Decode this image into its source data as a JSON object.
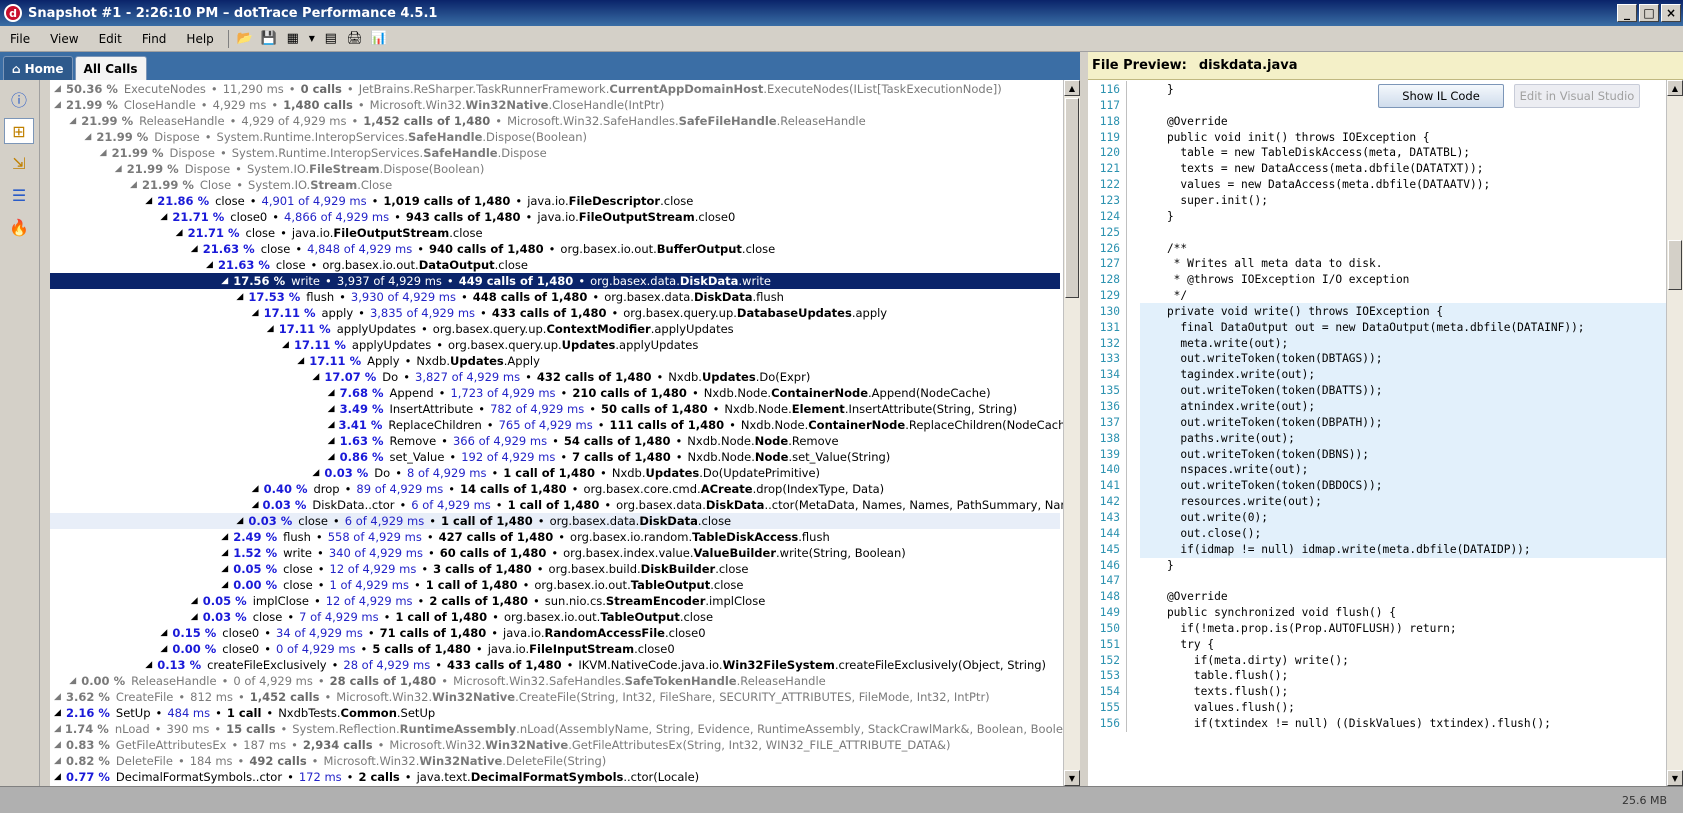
{
  "window": {
    "title": "Snapshot #1 - 2:26:10 PM – dotTrace Performance 4.5.1",
    "icon": "dottrace-logo-icon"
  },
  "menu": [
    "File",
    "View",
    "Edit",
    "Find",
    "Help"
  ],
  "tabs": [
    {
      "label": "Home",
      "icon": "home-icon"
    },
    {
      "label": "All Calls"
    }
  ],
  "sidebar": [
    "info-icon",
    "call-tree-icon",
    "back-traces-icon",
    "list-icon",
    "hotspots-icon"
  ],
  "preview": {
    "label": "File Preview:",
    "file": "diskdata.java",
    "show_il": "Show IL Code",
    "edit_vs": "Edit in Visual Studio"
  },
  "status": {
    "memory": "25.6 MB"
  },
  "tree": [
    {
      "d": 0,
      "g": 1,
      "pct": "50.36 %",
      "name": "ExecuteNodes",
      "ms": "11,290 ms",
      "calls": "0 calls",
      "pre": "JetBrains.ReSharper.TaskRunnerFramework.",
      "bold": "CurrentAppDomainHost",
      "post": ".ExecuteNodes(IList[TaskExecutionNode])"
    },
    {
      "d": 0,
      "g": 1,
      "pct": "21.99 %",
      "name": "CloseHandle",
      "ms": "4,929 ms",
      "calls": "1,480 calls",
      "pre": "Microsoft.Win32.",
      "bold": "Win32Native",
      "post": ".CloseHandle(IntPtr)"
    },
    {
      "d": 1,
      "g": 1,
      "pct": "21.99 %",
      "name": "ReleaseHandle",
      "ms": "4,929 of 4,929 ms",
      "calls": "1,452 calls of 1,480",
      "pre": "Microsoft.Win32.SafeHandles.",
      "bold": "SafeFileHandle",
      "post": ".ReleaseHandle"
    },
    {
      "d": 2,
      "g": 1,
      "pct": "21.99 %",
      "name": "Dispose",
      "ms": "",
      "calls": "",
      "pre": "System.Runtime.InteropServices.",
      "bold": "SafeHandle",
      "post": ".Dispose(Boolean)"
    },
    {
      "d": 3,
      "g": 1,
      "pct": "21.99 %",
      "name": "Dispose",
      "ms": "",
      "calls": "",
      "pre": "System.Runtime.InteropServices.",
      "bold": "SafeHandle",
      "post": ".Dispose"
    },
    {
      "d": 4,
      "g": 1,
      "pct": "21.99 %",
      "name": "Dispose",
      "ms": "",
      "calls": "",
      "pre": "System.IO.",
      "bold": "FileStream",
      "post": ".Dispose(Boolean)"
    },
    {
      "d": 5,
      "g": 1,
      "pct": "21.99 %",
      "name": "Close",
      "ms": "",
      "calls": "",
      "pre": "System.IO.",
      "bold": "Stream",
      "post": ".Close"
    },
    {
      "d": 6,
      "g": 0,
      "pct": "21.86 %",
      "name": "close",
      "ms": "4,901 of 4,929 ms",
      "calls": "1,019 calls of 1,480",
      "pre": "java.io.",
      "bold": "FileDescriptor",
      "post": ".close"
    },
    {
      "d": 7,
      "g": 0,
      "pct": "21.71 %",
      "name": "close0",
      "ms": "4,866 of 4,929 ms",
      "calls": "943 calls of 1,480",
      "pre": "java.io.",
      "bold": "FileOutputStream",
      "post": ".close0"
    },
    {
      "d": 8,
      "g": 0,
      "pct": "21.71 %",
      "name": "close",
      "ms": "",
      "calls": "",
      "pre": "java.io.",
      "bold": "FileOutputStream",
      "post": ".close"
    },
    {
      "d": 9,
      "g": 0,
      "pct": "21.63 %",
      "name": "close",
      "ms": "4,848 of 4,929 ms",
      "calls": "940 calls of 1,480",
      "pre": "org.basex.io.out.",
      "bold": "BufferOutput",
      "post": ".close"
    },
    {
      "d": 10,
      "g": 0,
      "pct": "21.63 %",
      "name": "close",
      "ms": "",
      "calls": "",
      "pre": "org.basex.io.out.",
      "bold": "DataOutput",
      "post": ".close"
    },
    {
      "d": 11,
      "g": 0,
      "pct": "17.56 %",
      "name": "write",
      "ms": "3,937 of 4,929 ms",
      "calls": "449 calls of 1,480",
      "pre": "org.basex.data.",
      "bold": "DiskData",
      "post": ".write",
      "sel": 1
    },
    {
      "d": 12,
      "g": 0,
      "pct": "17.53 %",
      "name": "flush",
      "ms": "3,930 of 4,929 ms",
      "calls": "448 calls of 1,480",
      "pre": "org.basex.data.",
      "bold": "DiskData",
      "post": ".flush"
    },
    {
      "d": 13,
      "g": 0,
      "pct": "17.11 %",
      "name": "apply",
      "ms": "3,835 of 4,929 ms",
      "calls": "433 calls of 1,480",
      "pre": "org.basex.query.up.",
      "bold": "DatabaseUpdates",
      "post": ".apply"
    },
    {
      "d": 14,
      "g": 0,
      "pct": "17.11 %",
      "name": "applyUpdates",
      "ms": "",
      "calls": "",
      "pre": "org.basex.query.up.",
      "bold": "ContextModifier",
      "post": ".applyUpdates"
    },
    {
      "d": 15,
      "g": 0,
      "pct": "17.11 %",
      "name": "applyUpdates",
      "ms": "",
      "calls": "",
      "pre": "org.basex.query.up.",
      "bold": "Updates",
      "post": ".applyUpdates"
    },
    {
      "d": 16,
      "g": 0,
      "pct": "17.11 %",
      "name": "Apply",
      "ms": "",
      "calls": "",
      "pre": "Nxdb.",
      "bold": "Updates",
      "post": ".Apply"
    },
    {
      "d": 17,
      "g": 0,
      "pct": "17.07 %",
      "name": "Do",
      "ms": "3,827 of 4,929 ms",
      "calls": "432 calls of 1,480",
      "pre": "Nxdb.",
      "bold": "Updates",
      "post": ".Do(Expr)"
    },
    {
      "d": 18,
      "g": 0,
      "pct": "7.68 %",
      "name": "Append",
      "ms": "1,723 of 4,929 ms",
      "calls": "210 calls of 1,480",
      "pre": "Nxdb.Node.",
      "bold": "ContainerNode",
      "post": ".Append(NodeCache)"
    },
    {
      "d": 18,
      "g": 0,
      "pct": "3.49 %",
      "name": "InsertAttribute",
      "ms": "782 of 4,929 ms",
      "calls": "50 calls of 1,480",
      "pre": "Nxdb.Node.",
      "bold": "Element",
      "post": ".InsertAttribute(String, String)"
    },
    {
      "d": 18,
      "g": 0,
      "pct": "3.41 %",
      "name": "ReplaceChildren",
      "ms": "765 of 4,929 ms",
      "calls": "111 calls of 1,480",
      "pre": "Nxdb.Node.",
      "bold": "ContainerNode",
      "post": ".ReplaceChildren(NodeCache)"
    },
    {
      "d": 18,
      "g": 0,
      "pct": "1.63 %",
      "name": "Remove",
      "ms": "366 of 4,929 ms",
      "calls": "54 calls of 1,480",
      "pre": "Nxdb.Node.",
      "bold": "Node",
      "post": ".Remove"
    },
    {
      "d": 18,
      "g": 0,
      "pct": "0.86 %",
      "name": "set_Value",
      "ms": "192 of 4,929 ms",
      "calls": "7 calls of 1,480",
      "pre": "Nxdb.Node.",
      "bold": "Node",
      "post": ".set_Value(String)"
    },
    {
      "d": 17,
      "g": 0,
      "pct": "0.03 %",
      "name": "Do",
      "ms": "8 of 4,929 ms",
      "calls": "1 call of 1,480",
      "pre": "Nxdb.",
      "bold": "Updates",
      "post": ".Do(UpdatePrimitive)"
    },
    {
      "d": 13,
      "g": 0,
      "pct": "0.40 %",
      "name": "drop",
      "ms": "89 of 4,929 ms",
      "calls": "14 calls of 1,480",
      "pre": "org.basex.core.cmd.",
      "bold": "ACreate",
      "post": ".drop(IndexType, Data)"
    },
    {
      "d": 13,
      "g": 0,
      "pct": "0.03 %",
      "name": "DiskData..ctor",
      "ms": "6 of 4,929 ms",
      "calls": "1 call of 1,480",
      "pre": "org.basex.data.",
      "bold": "DiskData",
      "post": "..ctor(MetaData, Names, Names, PathSummary, Namespaces)"
    },
    {
      "d": 12,
      "g": 0,
      "pct": "0.03 %",
      "name": "close",
      "ms": "6 of 4,929 ms",
      "calls": "1 call of 1,480",
      "pre": "org.basex.data.",
      "bold": "DiskData",
      "post": ".close",
      "hl": 1
    },
    {
      "d": 11,
      "g": 0,
      "pct": "2.49 %",
      "name": "flush",
      "ms": "558 of 4,929 ms",
      "calls": "427 calls of 1,480",
      "pre": "org.basex.io.random.",
      "bold": "TableDiskAccess",
      "post": ".flush"
    },
    {
      "d": 11,
      "g": 0,
      "pct": "1.52 %",
      "name": "write",
      "ms": "340 of 4,929 ms",
      "calls": "60 calls of 1,480",
      "pre": "org.basex.index.value.",
      "bold": "ValueBuilder",
      "post": ".write(String, Boolean)"
    },
    {
      "d": 11,
      "g": 0,
      "pct": "0.05 %",
      "name": "close",
      "ms": "12 of 4,929 ms",
      "calls": "3 calls of 1,480",
      "pre": "org.basex.build.",
      "bold": "DiskBuilder",
      "post": ".close"
    },
    {
      "d": 11,
      "g": 0,
      "pct": "0.00 %",
      "name": "close",
      "ms": "1 of 4,929 ms",
      "calls": "1 call of 1,480",
      "pre": "org.basex.io.out.",
      "bold": "TableOutput",
      "post": ".close"
    },
    {
      "d": 9,
      "g": 0,
      "pct": "0.05 %",
      "name": "implClose",
      "ms": "12 of 4,929 ms",
      "calls": "2 calls of 1,480",
      "pre": "sun.nio.cs.",
      "bold": "StreamEncoder",
      "post": ".implClose"
    },
    {
      "d": 9,
      "g": 0,
      "pct": "0.03 %",
      "name": "close",
      "ms": "7 of 4,929 ms",
      "calls": "1 call of 1,480",
      "pre": "org.basex.io.out.",
      "bold": "TableOutput",
      "post": ".close"
    },
    {
      "d": 7,
      "g": 0,
      "pct": "0.15 %",
      "name": "close0",
      "ms": "34 of 4,929 ms",
      "calls": "71 calls of 1,480",
      "pre": "java.io.",
      "bold": "RandomAccessFile",
      "post": ".close0"
    },
    {
      "d": 7,
      "g": 0,
      "pct": "0.00 %",
      "name": "close0",
      "ms": "0 of 4,929 ms",
      "calls": "5 calls of 1,480",
      "pre": "java.io.",
      "bold": "FileInputStream",
      "post": ".close0"
    },
    {
      "d": 6,
      "g": 0,
      "pct": "0.13 %",
      "name": "createFileExclusively",
      "ms": "28 of 4,929 ms",
      "calls": "433 calls of 1,480",
      "pre": "IKVM.NativeCode.java.io.",
      "bold": "Win32FileSystem",
      "post": ".createFileExclusively(Object, String)"
    },
    {
      "d": 1,
      "g": 1,
      "pct": "0.00 %",
      "name": "ReleaseHandle",
      "ms": "0 of 4,929 ms",
      "calls": "28 calls of 1,480",
      "pre": "Microsoft.Win32.SafeHandles.",
      "bold": "SafeTokenHandle",
      "post": ".ReleaseHandle"
    },
    {
      "d": 0,
      "g": 1,
      "pct": "3.62 %",
      "name": "CreateFile",
      "ms": "812 ms",
      "calls": "1,452 calls",
      "pre": "Microsoft.Win32.",
      "bold": "Win32Native",
      "post": ".CreateFile(String, Int32, FileShare, SECURITY_ATTRIBUTES, FileMode, Int32, IntPtr)"
    },
    {
      "d": 0,
      "g": 0,
      "pct": "2.16 %",
      "name": "SetUp",
      "ms": "484 ms",
      "calls": "1 call",
      "pre": "NxdbTests.",
      "bold": "Common",
      "post": ".SetUp"
    },
    {
      "d": 0,
      "g": 1,
      "pct": "1.74 %",
      "name": "nLoad",
      "ms": "390 ms",
      "calls": "15 calls",
      "pre": "System.Reflection.",
      "bold": "RuntimeAssembly",
      "post": ".nLoad(AssemblyName, String, Evidence, RuntimeAssembly, StackCrawlMark&, Boolean, Boolean, Boolean)"
    },
    {
      "d": 0,
      "g": 1,
      "pct": "0.83 %",
      "name": "GetFileAttributesEx",
      "ms": "187 ms",
      "calls": "2,934 calls",
      "pre": "Microsoft.Win32.",
      "bold": "Win32Native",
      "post": ".GetFileAttributesEx(String, Int32, WIN32_FILE_ATTRIBUTE_DATA&)"
    },
    {
      "d": 0,
      "g": 1,
      "pct": "0.82 %",
      "name": "DeleteFile",
      "ms": "184 ms",
      "calls": "492 calls",
      "pre": "Microsoft.Win32.",
      "bold": "Win32Native",
      "post": ".DeleteFile(String)"
    },
    {
      "d": 0,
      "g": 0,
      "pct": "0.77 %",
      "name": "DecimalFormatSymbols..ctor",
      "ms": "172 ms",
      "calls": "2 calls",
      "pre": "java.text.",
      "bold": "DecimalFormatSymbols",
      "post": "..ctor(Locale)"
    }
  ],
  "code": [
    {
      "n": "116",
      "t": "    }"
    },
    {
      "n": "117",
      "t": ""
    },
    {
      "n": "118",
      "t": "    @Override"
    },
    {
      "n": "119",
      "t": "    public void init() throws IOException {"
    },
    {
      "n": "120",
      "t": "      table = new TableDiskAccess(meta, DATATBL);"
    },
    {
      "n": "121",
      "t": "      texts = new DataAccess(meta.dbfile(DATATXT));"
    },
    {
      "n": "122",
      "t": "      values = new DataAccess(meta.dbfile(DATAATV));"
    },
    {
      "n": "123",
      "t": "      super.init();"
    },
    {
      "n": "124",
      "t": "    }"
    },
    {
      "n": "125",
      "t": ""
    },
    {
      "n": "126",
      "t": "    /**"
    },
    {
      "n": "127",
      "t": "     * Writes all meta data to disk."
    },
    {
      "n": "128",
      "t": "     * @throws IOException I/O exception"
    },
    {
      "n": "129",
      "t": "     */"
    },
    {
      "n": "130",
      "t": "    private void write() throws IOException {",
      "h": 1
    },
    {
      "n": "131",
      "t": "      final DataOutput out = new DataOutput(meta.dbfile(DATAINF));",
      "h": 1
    },
    {
      "n": "132",
      "t": "      meta.write(out);",
      "h": 1
    },
    {
      "n": "133",
      "t": "      out.writeToken(token(DBTAGS));",
      "h": 1
    },
    {
      "n": "134",
      "t": "      tagindex.write(out);",
      "h": 1
    },
    {
      "n": "135",
      "t": "      out.writeToken(token(DBATTS));",
      "h": 1
    },
    {
      "n": "136",
      "t": "      atnindex.write(out);",
      "h": 1
    },
    {
      "n": "137",
      "t": "      out.writeToken(token(DBPATH));",
      "h": 1
    },
    {
      "n": "138",
      "t": "      paths.write(out);",
      "h": 1
    },
    {
      "n": "139",
      "t": "      out.writeToken(token(DBNS));",
      "h": 1
    },
    {
      "n": "140",
      "t": "      nspaces.write(out);",
      "h": 1
    },
    {
      "n": "141",
      "t": "      out.writeToken(token(DBDOCS));",
      "h": 1
    },
    {
      "n": "142",
      "t": "      resources.write(out);",
      "h": 1
    },
    {
      "n": "143",
      "t": "      out.write(0);",
      "h": 1
    },
    {
      "n": "144",
      "t": "      out.close();",
      "h": 1
    },
    {
      "n": "145",
      "t": "      if(idmap != null) idmap.write(meta.dbfile(DATAIDP));",
      "h": 1
    },
    {
      "n": "146",
      "t": "    }"
    },
    {
      "n": "147",
      "t": ""
    },
    {
      "n": "148",
      "t": "    @Override"
    },
    {
      "n": "149",
      "t": "    public synchronized void flush() {"
    },
    {
      "n": "150",
      "t": "      if(!meta.prop.is(Prop.AUTOFLUSH)) return;"
    },
    {
      "n": "151",
      "t": "      try {"
    },
    {
      "n": "152",
      "t": "        if(meta.dirty) write();"
    },
    {
      "n": "153",
      "t": "        table.flush();"
    },
    {
      "n": "154",
      "t": "        texts.flush();"
    },
    {
      "n": "155",
      "t": "        values.flush();"
    },
    {
      "n": "156",
      "t": "        if(txtindex != null) ((DiskValues) txtindex).flush();"
    }
  ]
}
